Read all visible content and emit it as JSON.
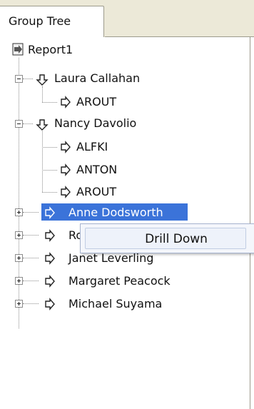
{
  "tab": {
    "label": "Group Tree"
  },
  "tree": {
    "root": "Report1",
    "nodes": [
      {
        "label": "Laura Callahan",
        "expanded": true,
        "children": [
          "AROUT"
        ]
      },
      {
        "label": "Nancy Davolio",
        "expanded": true,
        "children": [
          "ALFKI",
          "ANTON",
          "AROUT"
        ]
      },
      {
        "label": "Anne Dodsworth",
        "expanded": false,
        "selected": true
      },
      {
        "label": "Robert King",
        "expanded": false
      },
      {
        "label": "Janet Leverling",
        "expanded": false
      },
      {
        "label": "Margaret Peacock",
        "expanded": false
      },
      {
        "label": "Michael Suyama",
        "expanded": false
      }
    ]
  },
  "context_menu": {
    "items": [
      "Drill Down"
    ]
  },
  "colors": {
    "selection": "#3b73d9",
    "panel_bg": "#ece9d8"
  }
}
